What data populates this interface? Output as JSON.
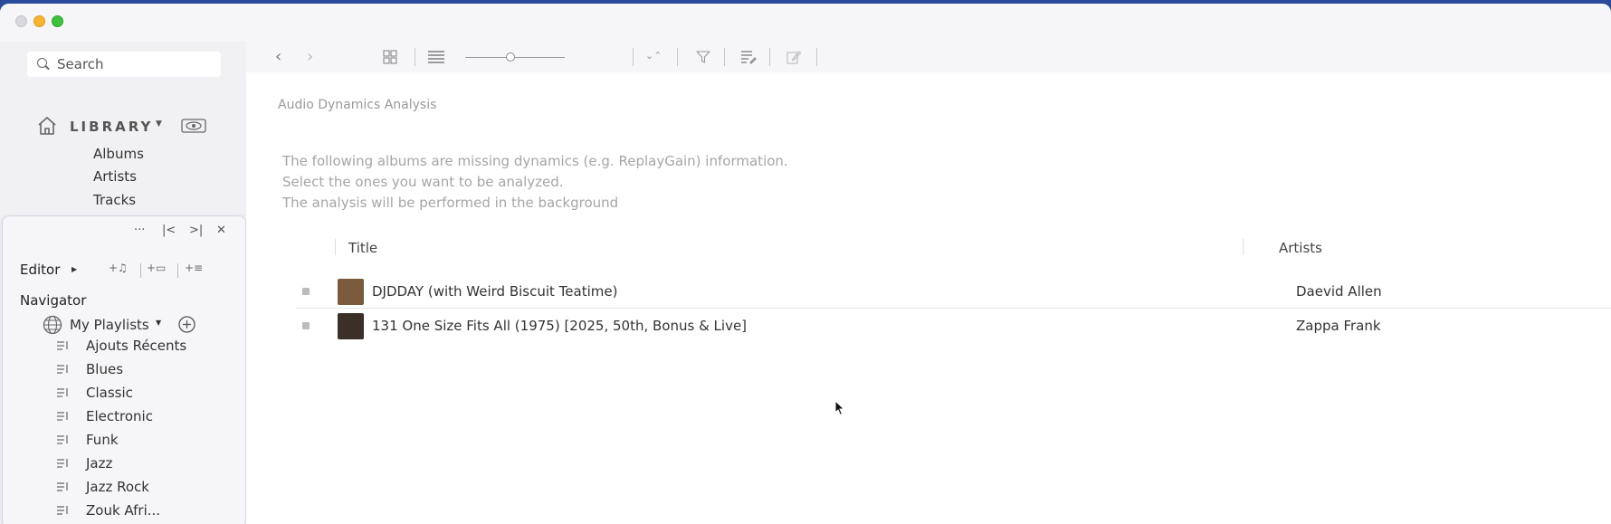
{
  "search": {
    "placeholder": "Search"
  },
  "library": {
    "label": "LIBRARY",
    "items": [
      "Albums",
      "Artists",
      "Tracks"
    ]
  },
  "panel": {
    "more_label": "···",
    "prev_label": "|<",
    "next_label": ">|",
    "close_label": "✕",
    "editor_label": "Editor",
    "editor_tools": [
      "+♫",
      "+▭",
      "+≡"
    ],
    "navigator_label": "Navigator",
    "playlists_label": "My Playlists",
    "playlists": [
      "Ajouts Récents",
      "Blues",
      "Classic",
      "Electronic",
      "Funk",
      "Jazz",
      "Jazz Rock",
      "Zouk Afri..."
    ]
  },
  "main": {
    "section_title": "Audio Dynamics Analysis",
    "description": [
      "The following albums are missing dynamics (e.g. ReplayGain) information.",
      "Select the ones you want to be analyzed.",
      "The analysis will be performed in the background"
    ],
    "columns": {
      "title": "Title",
      "artists": "Artists"
    },
    "rows": [
      {
        "title": "DJDDAY (with Weird Biscuit Teatime)",
        "artist": "Daevid Allen",
        "thumb_color": "#7a5a3c"
      },
      {
        "title": "131 One Size Fits All (1975) [2025, 50th, Bonus & Live]",
        "artist": "Zappa Frank",
        "thumb_color": "#3a3028"
      }
    ]
  },
  "icons": {
    "back": "back-arrow-icon",
    "forward": "forward-arrow-icon",
    "grid": "grid-view-icon",
    "list": "list-view-icon",
    "sort": "sort-icon",
    "filter": "filter-icon",
    "playlist_edit": "playlist-edit-icon",
    "edit": "edit-icon"
  },
  "colors": {
    "accent": "#2a4a9a",
    "sidebar": "#f1f0f3"
  }
}
